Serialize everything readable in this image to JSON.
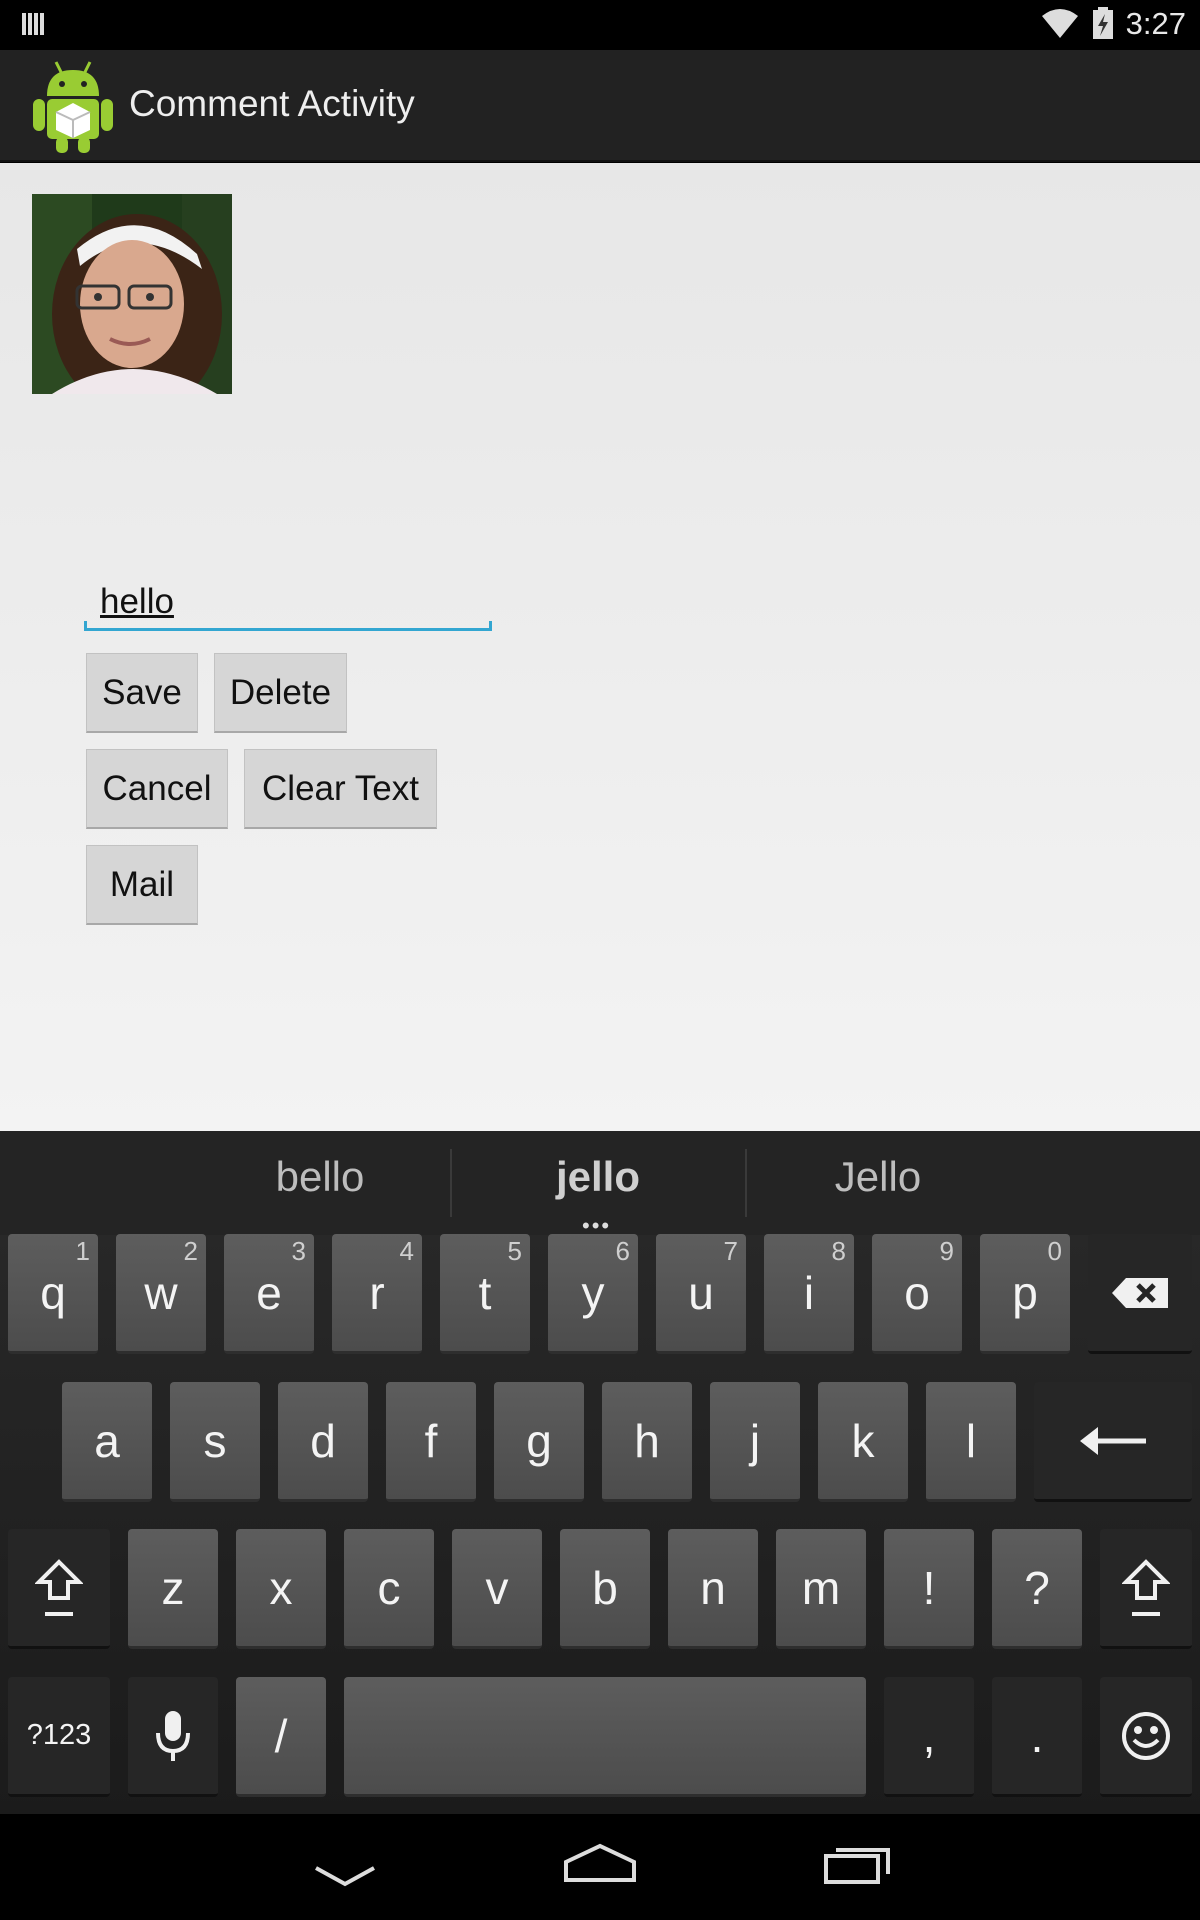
{
  "status_bar": {
    "time": "3:27",
    "icons": [
      "notification-icon",
      "wifi-icon",
      "battery-charging-icon"
    ]
  },
  "action_bar": {
    "title": "Comment Activity",
    "icon": "android-app-icon"
  },
  "content": {
    "avatar": "profile-photo",
    "comment_value": "hello",
    "buttons": {
      "save": "Save",
      "delete": "Delete",
      "cancel": "Cancel",
      "clear": "Clear Text",
      "mail": "Mail"
    }
  },
  "keyboard": {
    "suggestions": [
      "bello",
      "jello",
      "Jello"
    ],
    "row1": [
      {
        "k": "q",
        "h": "1"
      },
      {
        "k": "w",
        "h": "2"
      },
      {
        "k": "e",
        "h": "3"
      },
      {
        "k": "r",
        "h": "4"
      },
      {
        "k": "t",
        "h": "5"
      },
      {
        "k": "y",
        "h": "6"
      },
      {
        "k": "u",
        "h": "7"
      },
      {
        "k": "i",
        "h": "8"
      },
      {
        "k": "o",
        "h": "9"
      },
      {
        "k": "p",
        "h": "0"
      }
    ],
    "row2": [
      "a",
      "s",
      "d",
      "f",
      "g",
      "h",
      "j",
      "k",
      "l"
    ],
    "row3": [
      "z",
      "x",
      "c",
      "v",
      "b",
      "n",
      "m",
      "!",
      "?"
    ],
    "row4": {
      "symbols": "?123",
      "slash": "/",
      "comma": ",",
      "period": "."
    },
    "icons": [
      "backspace-icon",
      "enter-icon",
      "shift-icon",
      "mic-icon",
      "emoji-icon"
    ]
  },
  "nav_bar": {
    "icons": [
      "back-icon",
      "home-icon",
      "recents-icon"
    ]
  },
  "colors": {
    "accent": "#33a6d1",
    "action_bar": "#222222",
    "key": "#555555"
  }
}
